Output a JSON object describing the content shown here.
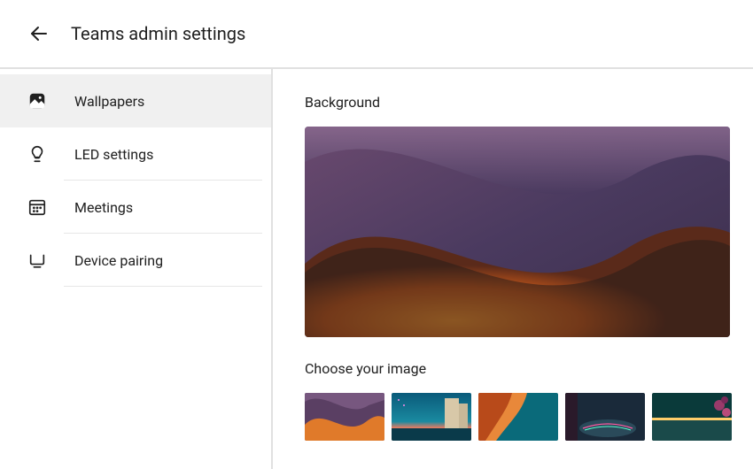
{
  "header": {
    "title": "Teams admin settings"
  },
  "sidebar": {
    "items": [
      {
        "label": "Wallpapers",
        "icon": "wallpaper-icon",
        "active": true
      },
      {
        "label": "LED settings",
        "icon": "bulb-icon",
        "active": false
      },
      {
        "label": "Meetings",
        "icon": "calendar-icon",
        "active": false
      },
      {
        "label": "Device pairing",
        "icon": "monitor-icon",
        "active": false
      }
    ]
  },
  "main": {
    "background_heading": "Background",
    "choose_heading": "Choose your image",
    "thumbnails": [
      {
        "name": "abstract-wave-purple"
      },
      {
        "name": "sunset-pool"
      },
      {
        "name": "abstract-wave-orange"
      },
      {
        "name": "neon-pool-night"
      },
      {
        "name": "garden-lights"
      }
    ]
  }
}
